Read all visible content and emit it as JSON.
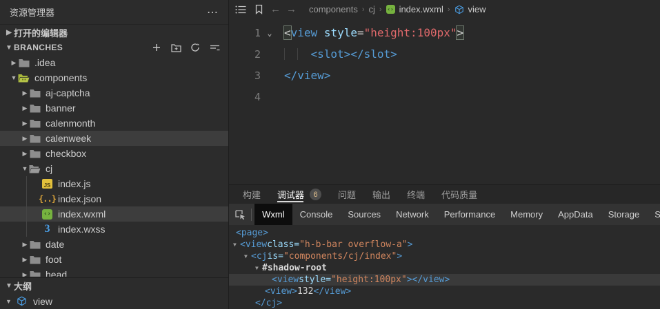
{
  "colors": {
    "tag_blue": "#569cd6",
    "attr_cyan": "#9cdcfe",
    "string_red": "#e0696b",
    "value_orange": "#d3875f",
    "badge_text": "#e2c08d",
    "wxml_green": "#76b23f",
    "wxss_blue": "#4ba0e8",
    "js_yellow": "#e2c03c",
    "components_folder_green": "#a9b83c",
    "active_tab_bg": "#0d0d0d",
    "selection_row": "#3d3d3d"
  },
  "sidebar": {
    "title": "资源管理器",
    "more_icon": "⋯",
    "open_editors_label": "打开的编辑器",
    "branches_label": "BRANCHES",
    "outline_label": "大纲",
    "outline_items": [
      {
        "label": "view",
        "icon": "cube"
      }
    ],
    "tree": [
      {
        "label": ".idea",
        "level": 1,
        "icon": "folder",
        "chevron": "right"
      },
      {
        "label": "components",
        "level": 1,
        "icon": "folder-components",
        "chevron": "down"
      },
      {
        "label": "aj-captcha",
        "level": 2,
        "icon": "folder",
        "chevron": "right"
      },
      {
        "label": "banner",
        "level": 2,
        "icon": "folder",
        "chevron": "right"
      },
      {
        "label": "calenmonth",
        "level": 2,
        "icon": "folder",
        "chevron": "right"
      },
      {
        "label": "calenweek",
        "level": 2,
        "icon": "folder",
        "chevron": "right",
        "highlighted": true
      },
      {
        "label": "checkbox",
        "level": 2,
        "icon": "folder",
        "chevron": "right"
      },
      {
        "label": "cj",
        "level": 2,
        "icon": "folder-open",
        "chevron": "down"
      },
      {
        "label": "index.js",
        "level": 3,
        "icon": "js"
      },
      {
        "label": "index.json",
        "level": 3,
        "icon": "json"
      },
      {
        "label": "index.wxml",
        "level": 3,
        "icon": "wxml",
        "highlighted": true
      },
      {
        "label": "index.wxss",
        "level": 3,
        "icon": "wxss"
      },
      {
        "label": "date",
        "level": 2,
        "icon": "folder",
        "chevron": "right"
      },
      {
        "label": "foot",
        "level": 2,
        "icon": "folder",
        "chevron": "right"
      },
      {
        "label": "head",
        "level": 2,
        "icon": "folder",
        "chevron": "right"
      }
    ]
  },
  "breadcrumb": {
    "items": [
      "components",
      "cj",
      "index.wxml",
      "view"
    ],
    "separator": "›"
  },
  "editor": {
    "lines": [
      {
        "num": "1",
        "fold": true,
        "tokens": [
          {
            "t": "<",
            "c": "boxed"
          },
          {
            "t": "view",
            "c": "tag"
          },
          {
            "t": " ",
            "c": "plain"
          },
          {
            "t": "style",
            "c": "attr"
          },
          {
            "t": "=",
            "c": "plain"
          },
          {
            "t": "\"height:100px\"",
            "c": "str"
          },
          {
            "t": ">",
            "c": "boxed"
          }
        ]
      },
      {
        "num": "2",
        "indent_chars": 4,
        "guides": [
          0,
          2
        ],
        "tokens": [
          {
            "t": "<slot></slot>",
            "c": "tag"
          }
        ]
      },
      {
        "num": "3",
        "tokens": [
          {
            "t": "</view>",
            "c": "tag"
          }
        ]
      },
      {
        "num": "4",
        "tokens": []
      }
    ]
  },
  "panel": {
    "tabs": [
      {
        "label": "构建"
      },
      {
        "label": "调试器",
        "active": true,
        "badge": "6"
      },
      {
        "label": "问题"
      },
      {
        "label": "输出"
      },
      {
        "label": "终端"
      },
      {
        "label": "代码质量"
      }
    ],
    "devtools_tabs": [
      {
        "label": "Wxml",
        "active": true
      },
      {
        "label": "Console"
      },
      {
        "label": "Sources"
      },
      {
        "label": "Network"
      },
      {
        "label": "Performance"
      },
      {
        "label": "Memory"
      },
      {
        "label": "AppData"
      },
      {
        "label": "Storage"
      },
      {
        "label": "Sens"
      }
    ],
    "dom_tree": [
      {
        "indent": 10,
        "tri": false,
        "tokens": [
          {
            "t": "<page>",
            "c": "tag"
          }
        ]
      },
      {
        "indent": 6,
        "tri": true,
        "tokens": [
          {
            "t": "<view ",
            "c": "tag"
          },
          {
            "t": "class=",
            "c": "attr"
          },
          {
            "t": "\"h-b-bar overflow-a\"",
            "c": "val"
          },
          {
            "t": ">",
            "c": "tag"
          }
        ]
      },
      {
        "indent": 22,
        "tri": true,
        "tokens": [
          {
            "t": "<cj ",
            "c": "tag"
          },
          {
            "t": "is=",
            "c": "attr"
          },
          {
            "t": "\"components/cj/index\"",
            "c": "val"
          },
          {
            "t": ">",
            "c": "tag"
          }
        ]
      },
      {
        "indent": 38,
        "tri": true,
        "tokens": [
          {
            "t": "#shadow-root",
            "c": "shadow"
          }
        ]
      },
      {
        "indent": 62,
        "tri": false,
        "highlighted": true,
        "tokens": [
          {
            "t": "<view ",
            "c": "tag"
          },
          {
            "t": "style=",
            "c": "attr"
          },
          {
            "t": "\"height:100px\"",
            "c": "val"
          },
          {
            "t": "></view>",
            "c": "tag"
          }
        ]
      },
      {
        "indent": 52,
        "tri": false,
        "tokens": [
          {
            "t": "<view>",
            "c": "tag"
          },
          {
            "t": "132",
            "c": "plain"
          },
          {
            "t": "</view>",
            "c": "tag"
          }
        ]
      },
      {
        "indent": 38,
        "tri": false,
        "tokens": [
          {
            "t": "</cj>",
            "c": "tag"
          }
        ]
      }
    ]
  }
}
